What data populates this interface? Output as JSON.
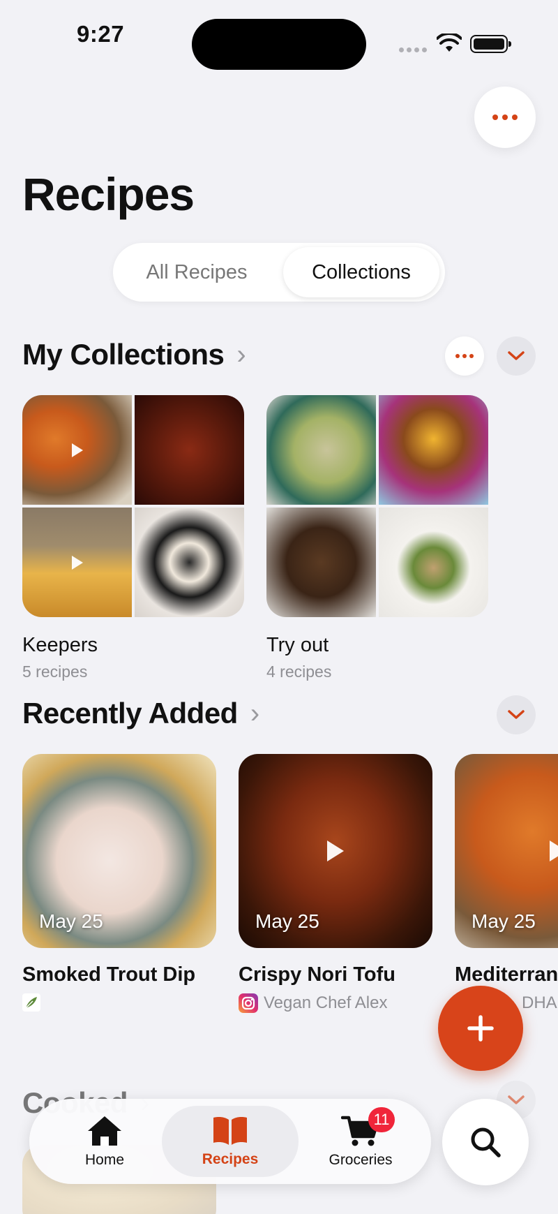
{
  "status_bar": {
    "time": "9:27"
  },
  "header": {
    "title": "Recipes"
  },
  "segmented_control": {
    "options": [
      "All Recipes",
      "Collections"
    ],
    "selected": "Collections"
  },
  "my_collections": {
    "title": "My Collections",
    "items": [
      {
        "name": "Keepers",
        "count": "5 recipes"
      },
      {
        "name": "Try out",
        "count": "4 recipes"
      }
    ]
  },
  "recently_added": {
    "title": "Recently Added",
    "items": [
      {
        "date": "May 25",
        "title": "Smoked Trout Dip",
        "source": ""
      },
      {
        "date": "May 25",
        "title": "Crispy Nori Tofu",
        "source": "Vegan Chef Alex"
      },
      {
        "date": "May 25",
        "title": "Mediterranean Roasted Ca",
        "source": "DHA"
      }
    ]
  },
  "cooked": {
    "title": "Cooked"
  },
  "tab_bar": {
    "home": "Home",
    "recipes": "Recipes",
    "groceries": "Groceries",
    "groceries_badge": "11"
  },
  "colors": {
    "accent": "#d44316",
    "badge": "#f0253a",
    "background": "#f2f2f6"
  },
  "icons": [
    "more-icon",
    "chevron-right-icon",
    "chevron-down-icon",
    "play-icon",
    "plus-icon",
    "home-icon",
    "book-icon",
    "cart-icon",
    "search-icon",
    "instagram-icon",
    "leaf-icon"
  ]
}
